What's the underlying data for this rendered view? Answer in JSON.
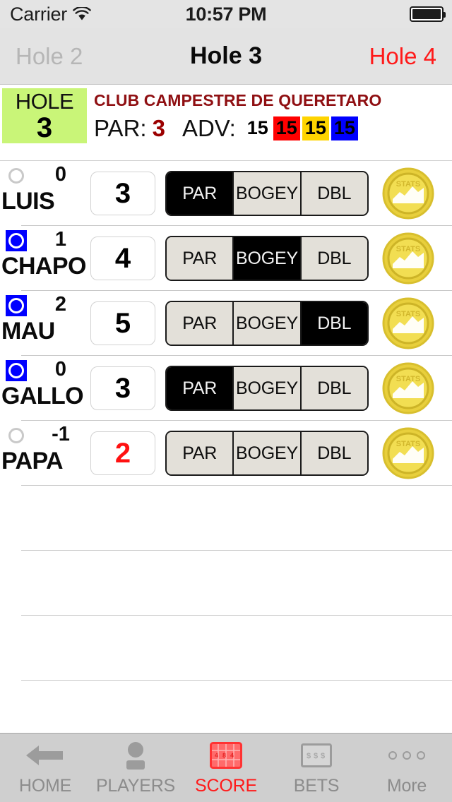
{
  "status_bar": {
    "carrier": "Carrier",
    "wifi_icon": "wifi-icon",
    "time": "10:57 PM",
    "battery_icon": "battery-full-icon"
  },
  "nav": {
    "prev_label": "Hole 2",
    "title": "Hole 3",
    "next_label": "Hole 4",
    "next_color": "#ff1a1a",
    "prev_color": "#b6b6b6"
  },
  "hole_header": {
    "badge_label": "HOLE",
    "badge_number": "3",
    "badge_color": "#c9f578",
    "club_name": "CLUB CAMPESTRE DE QUERETARO",
    "club_color": "#8f0f12",
    "par_label": "PAR:",
    "par_value": "3",
    "par_color": "#9b0000",
    "adv_label": "ADV:",
    "adv_chips": [
      {
        "value": "15",
        "style": "plain",
        "bg": "transparent"
      },
      {
        "value": "15",
        "style": "red",
        "bg": "#ff0000"
      },
      {
        "value": "15",
        "style": "yellow",
        "bg": "#ffd400"
      },
      {
        "value": "15",
        "style": "blue",
        "bg": "#0000ff"
      }
    ]
  },
  "segment_labels": {
    "par": "PAR",
    "bogey": "BOGEY",
    "dbl": "DBL"
  },
  "stats_icon_label": "STATS",
  "players": [
    {
      "name": "LUIS",
      "differential": "0",
      "selected": false,
      "score": "3",
      "score_under_par": false,
      "segments": {
        "par": "PAR",
        "bogey": "BOGEY",
        "dbl": "DBL"
      },
      "selected_segment": "par",
      "stats_icon": "stats-coin-icon"
    },
    {
      "name": "CHAPO",
      "differential": "1",
      "selected": true,
      "score": "4",
      "score_under_par": false,
      "segments": {
        "par": "PAR",
        "bogey": "BOGEY",
        "dbl": "DBL"
      },
      "selected_segment": "bogey",
      "stats_icon": "stats-coin-icon"
    },
    {
      "name": "MAU",
      "differential": "2",
      "selected": true,
      "score": "5",
      "score_under_par": false,
      "segments": {
        "par": "PAR",
        "bogey": "BOGEY",
        "dbl": "DBL"
      },
      "selected_segment": "dbl",
      "stats_icon": "stats-coin-icon"
    },
    {
      "name": "GALLO",
      "differential": "0",
      "selected": true,
      "score": "3",
      "score_under_par": false,
      "segments": {
        "par": "PAR",
        "bogey": "BOGEY",
        "dbl": "DBL"
      },
      "selected_segment": "par",
      "stats_icon": "stats-coin-icon"
    },
    {
      "name": "PAPA",
      "differential": "-1",
      "selected": false,
      "score": "2",
      "score_under_par": true,
      "segments": {
        "par": "PAR",
        "bogey": "BOGEY",
        "dbl": "DBL"
      },
      "selected_segment": "none",
      "stats_icon": "stats-coin-icon"
    }
  ],
  "empty_row_count": 4,
  "tabbar": {
    "items": [
      {
        "label": "HOME",
        "icon": "back-arrow-icon",
        "active": false
      },
      {
        "label": "PLAYERS",
        "icon": "person-icon",
        "active": false
      },
      {
        "label": "SCORE",
        "icon": "scorecard-icon",
        "active": true
      },
      {
        "label": "BETS",
        "icon": "money-bill-icon",
        "active": false
      },
      {
        "label": "More",
        "icon": "ellipsis-icon",
        "active": false
      }
    ],
    "active_color": "#ff1a1a",
    "inactive_color": "#8c8c8c"
  }
}
